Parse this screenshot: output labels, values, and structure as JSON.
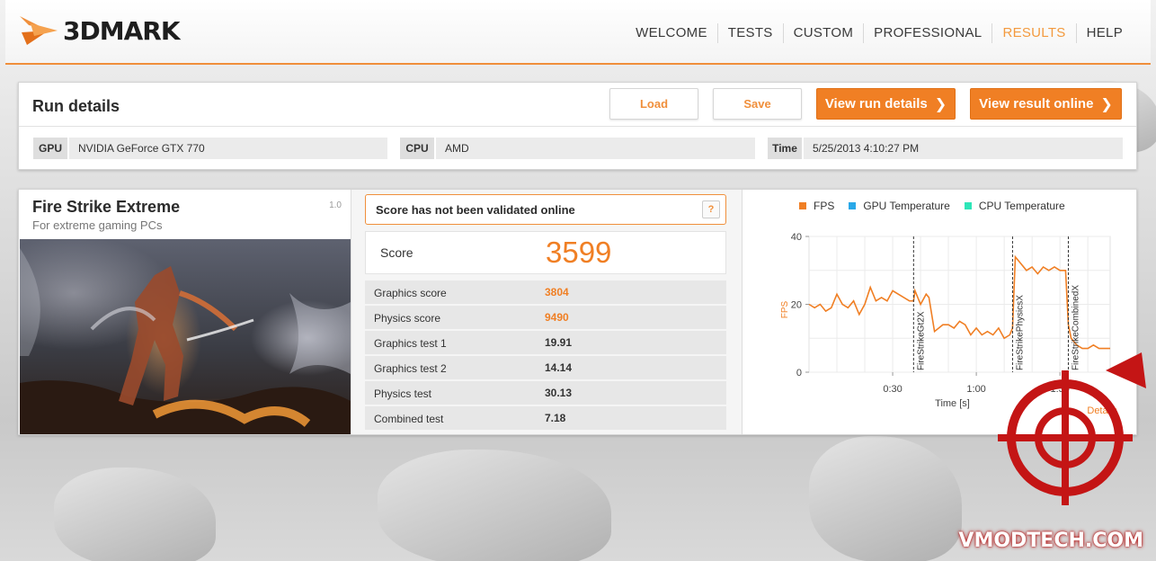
{
  "app": {
    "logo_text": "3DMARK"
  },
  "nav": {
    "items": [
      {
        "label": "WELCOME"
      },
      {
        "label": "TESTS"
      },
      {
        "label": "CUSTOM"
      },
      {
        "label": "PROFESSIONAL"
      },
      {
        "label": "RESULTS",
        "active": true
      },
      {
        "label": "HELP"
      }
    ]
  },
  "run_details": {
    "title": "Run details",
    "load_label": "Load",
    "save_label": "Save",
    "view_run_label": "View run details",
    "view_online_label": "View result online",
    "gpu_label": "GPU",
    "gpu_value": "NVIDIA GeForce GTX 770",
    "cpu_label": "CPU",
    "cpu_value": "AMD",
    "time_label": "Time",
    "time_value": "5/25/2013 4:10:27 PM"
  },
  "benchmark": {
    "name": "Fire Strike Extreme",
    "subtitle": "For extreme gaming PCs",
    "version": "1.0"
  },
  "result": {
    "validation_message": "Score has not been validated online",
    "help_label": "?",
    "score_label": "Score",
    "score_value": "3599",
    "rows": [
      {
        "label": "Graphics score",
        "value": "3804",
        "highlight": true
      },
      {
        "label": "Physics score",
        "value": "9490",
        "highlight": true
      },
      {
        "label": "Graphics test 1",
        "value": "19.91"
      },
      {
        "label": "Graphics test 2",
        "value": "14.14"
      },
      {
        "label": "Physics test",
        "value": "30.13"
      },
      {
        "label": "Combined test",
        "value": "7.18"
      }
    ]
  },
  "graph": {
    "legend": [
      {
        "label": "FPS",
        "color": "#f07f24"
      },
      {
        "label": "GPU Temperature",
        "color": "#29a8e8"
      },
      {
        "label": "CPU Temperature",
        "color": "#2ee6b8"
      }
    ],
    "y_axis_label": "FPS",
    "x_axis_label": "Time [s]",
    "y_ticks": [
      "40",
      "20",
      "0"
    ],
    "x_ticks": [
      "0:30",
      "1:00",
      "1:30"
    ],
    "markers": [
      "FireStrikeGt2X",
      "FireStrikePhysicsX",
      "FireStrikeCombinedX"
    ],
    "details_label": "Details"
  },
  "chart_data": {
    "type": "line",
    "xlabel": "Time [s]",
    "ylabel": "FPS",
    "ylim": [
      0,
      40
    ],
    "xlim": [
      0,
      108
    ],
    "series": [
      {
        "name": "FPS",
        "x": [
          0,
          2,
          4,
          6,
          8,
          10,
          12,
          14,
          16,
          18,
          20,
          22,
          24,
          26,
          28,
          30,
          32,
          34,
          36,
          37.5,
          38,
          40,
          42,
          43,
          45,
          48,
          50,
          52,
          54,
          56,
          58,
          60,
          62,
          64,
          66,
          68,
          70,
          72,
          73,
          74,
          76,
          78,
          80,
          82,
          84,
          86,
          88,
          90,
          92,
          93,
          94,
          96,
          98,
          100,
          102,
          104,
          106,
          108
        ],
        "y": [
          20,
          19,
          20,
          18,
          19,
          23,
          20,
          19,
          21,
          17,
          20,
          25,
          21,
          22,
          21,
          24,
          23,
          22,
          21,
          21,
          24,
          20,
          23,
          22,
          12,
          14,
          14,
          13,
          15,
          14,
          11,
          13,
          11,
          12,
          11,
          13,
          10,
          11,
          13,
          34,
          32,
          30,
          31,
          29,
          31,
          30,
          31,
          30,
          30,
          14,
          10,
          8,
          7,
          7,
          8,
          7,
          7,
          7
        ]
      }
    ],
    "markers": [
      {
        "label": "FireStrikeGt2X",
        "x": 37.5
      },
      {
        "label": "FireStrikePhysicsX",
        "x": 73
      },
      {
        "label": "FireStrikeCombinedX",
        "x": 93
      }
    ],
    "grid": true
  },
  "watermark": {
    "text": "VMODTECH.COM"
  }
}
